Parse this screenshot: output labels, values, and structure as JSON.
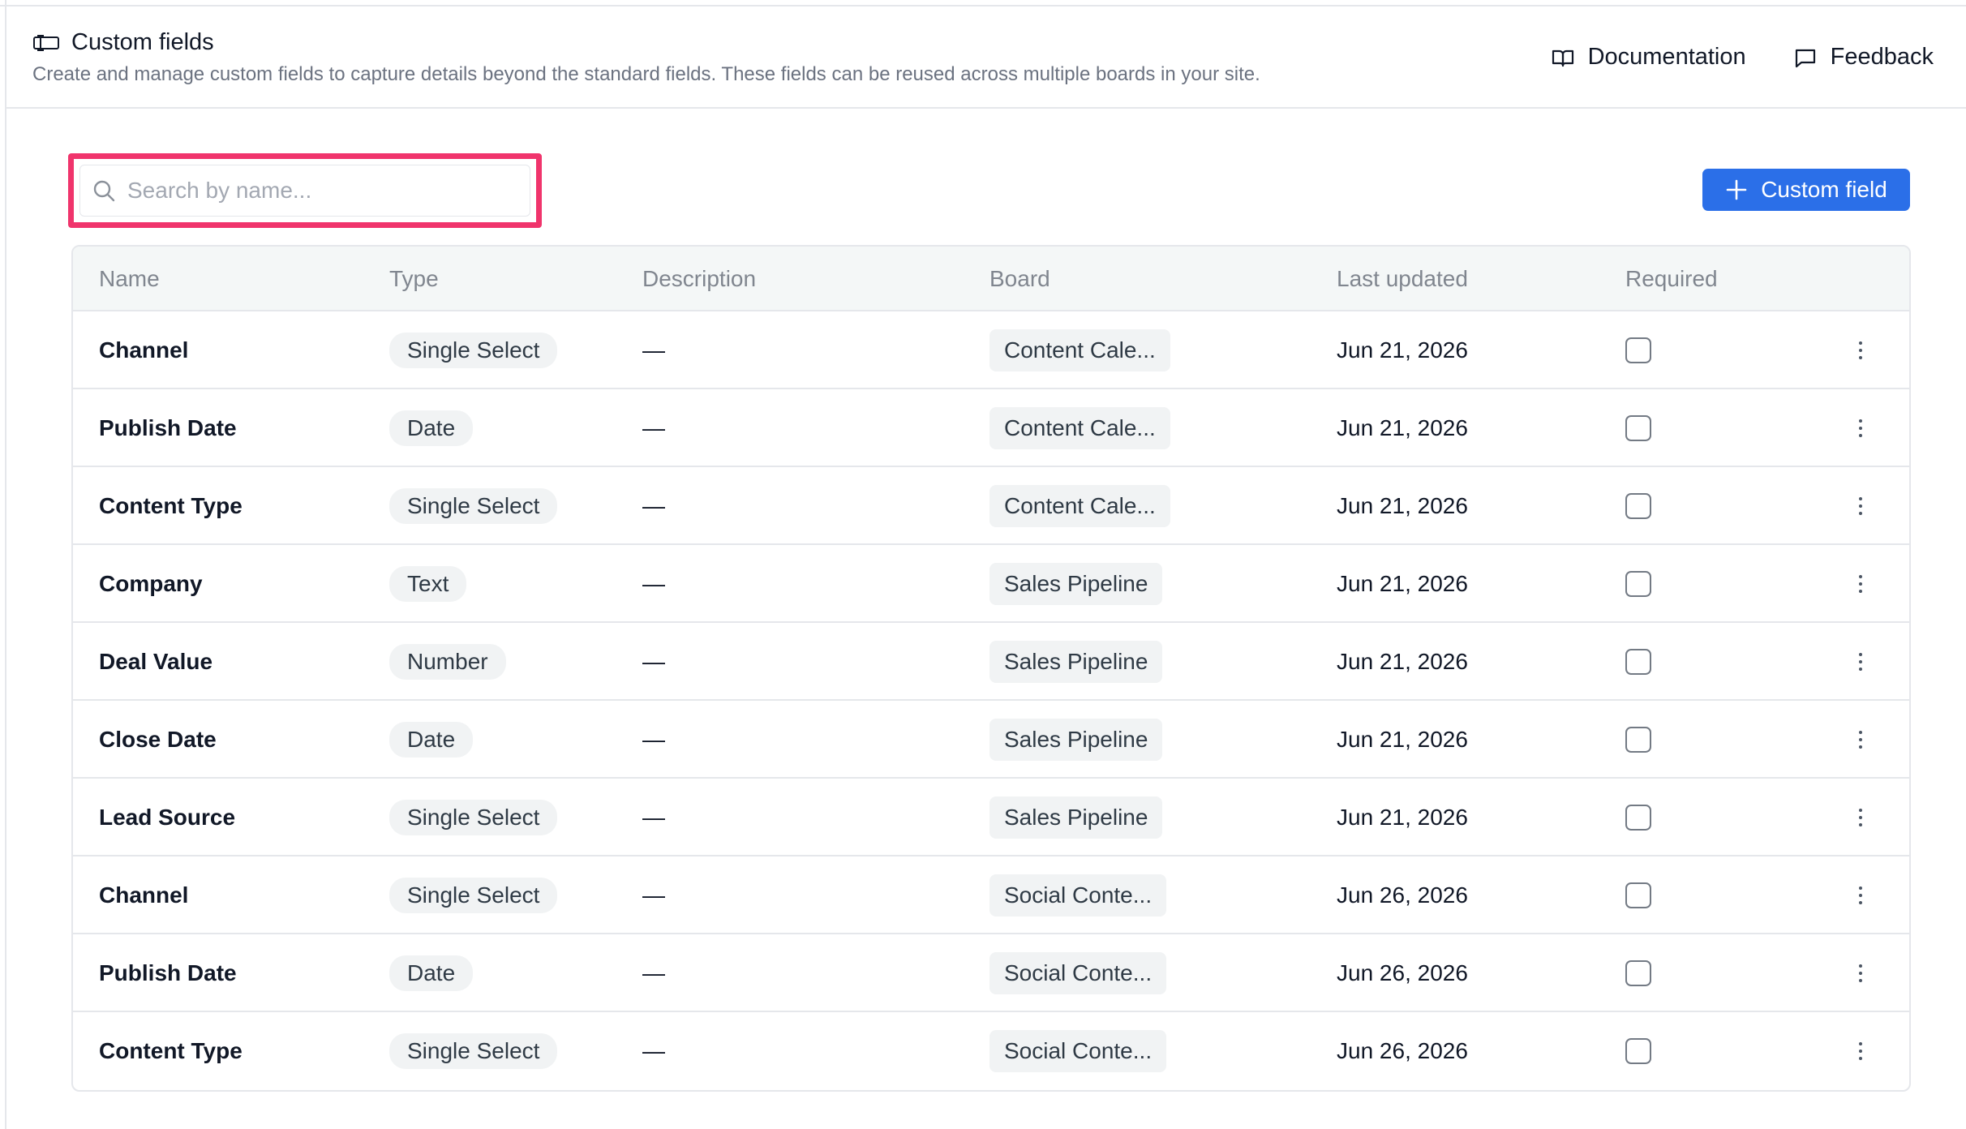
{
  "header": {
    "title": "Custom fields",
    "subtitle": "Create and manage custom fields to capture details beyond the standard fields. These fields can be reused across multiple boards in your site.",
    "title_icon": "custom-fields-icon",
    "links": [
      {
        "label": "Documentation",
        "icon": "book-icon"
      },
      {
        "label": "Feedback",
        "icon": "message-icon"
      }
    ]
  },
  "toolbar": {
    "search_placeholder": "Search by name...",
    "search_value": "",
    "add_button_label": "Custom field",
    "add_button_color": "#2b6fe8",
    "highlight_color": "#f0346c"
  },
  "table": {
    "columns": [
      "Name",
      "Type",
      "Description",
      "Board",
      "Last updated",
      "Required"
    ],
    "rows": [
      {
        "name": "Channel",
        "type": "Single Select",
        "description": "—",
        "board": "Content Cale...",
        "last_updated": "Jun 21, 2026",
        "required": false
      },
      {
        "name": "Publish Date",
        "type": "Date",
        "description": "—",
        "board": "Content Cale...",
        "last_updated": "Jun 21, 2026",
        "required": false
      },
      {
        "name": "Content Type",
        "type": "Single Select",
        "description": "—",
        "board": "Content Cale...",
        "last_updated": "Jun 21, 2026",
        "required": false
      },
      {
        "name": "Company",
        "type": "Text",
        "description": "—",
        "board": "Sales Pipeline",
        "last_updated": "Jun 21, 2026",
        "required": false
      },
      {
        "name": "Deal Value",
        "type": "Number",
        "description": "—",
        "board": "Sales Pipeline",
        "last_updated": "Jun 21, 2026",
        "required": false
      },
      {
        "name": "Close Date",
        "type": "Date",
        "description": "—",
        "board": "Sales Pipeline",
        "last_updated": "Jun 21, 2026",
        "required": false
      },
      {
        "name": "Lead Source",
        "type": "Single Select",
        "description": "—",
        "board": "Sales Pipeline",
        "last_updated": "Jun 21, 2026",
        "required": false
      },
      {
        "name": "Channel",
        "type": "Single Select",
        "description": "—",
        "board": "Social Conte...",
        "last_updated": "Jun 26, 2026",
        "required": false
      },
      {
        "name": "Publish Date",
        "type": "Date",
        "description": "—",
        "board": "Social Conte...",
        "last_updated": "Jun 26, 2026",
        "required": false
      },
      {
        "name": "Content Type",
        "type": "Single Select",
        "description": "—",
        "board": "Social Conte...",
        "last_updated": "Jun 26, 2026",
        "required": false
      }
    ]
  }
}
